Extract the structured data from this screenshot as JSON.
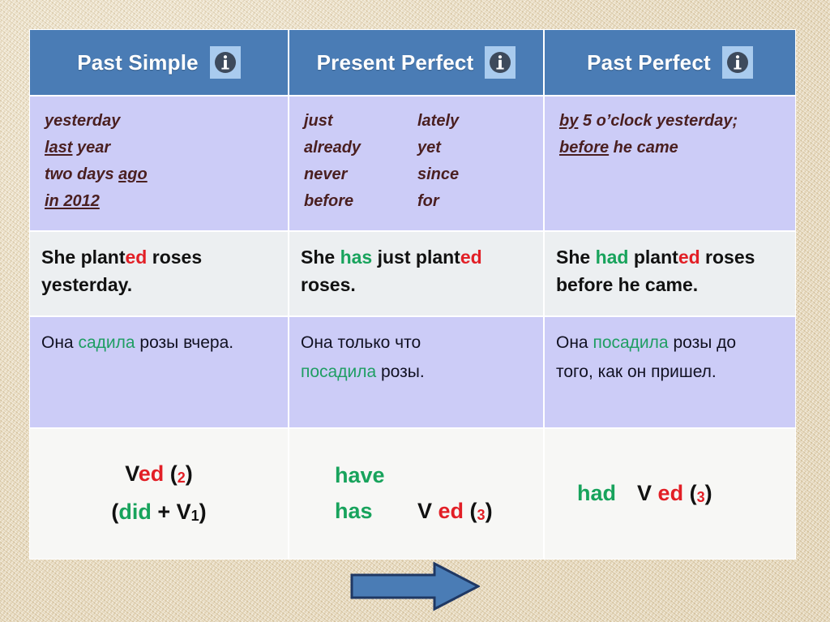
{
  "page": {
    "title": "English Tenses Comparison Table",
    "background_color": "#e8dcc0"
  },
  "colors": {
    "header_blue": "#4a7cb5",
    "info_badge_blue": "#a9cbee",
    "lavender_row": "#ccccf7",
    "light_row": "#eceff1",
    "formula_row": "#f7f7f5",
    "red_accent": "#e21f26",
    "green_accent": "#18a35c",
    "marker_text": "#4a1f20",
    "arrow_fill": "#4a7cb5",
    "arrow_outline": "#1f3864"
  },
  "table": {
    "headers": [
      {
        "label": "Past Simple",
        "icon": "info-icon"
      },
      {
        "label": "Present Perfect",
        "icon": "info-icon"
      },
      {
        "label": "Past Perfect",
        "icon": "info-icon"
      }
    ],
    "markers": {
      "past_simple": {
        "lines": [
          {
            "plain": "yesterday",
            "underlined": ""
          },
          {
            "underlined": "last",
            "plain": " year"
          },
          {
            "plain": "two days ",
            "underlined": "ago"
          },
          {
            "underlined": "in 2012",
            "plain": ""
          }
        ],
        "col_a": [
          "yesterday",
          "last year",
          "two days ago",
          "in 2012"
        ]
      },
      "present_perfect": {
        "col_a": [
          "just",
          "already",
          "never",
          "before"
        ],
        "col_b": [
          "lately",
          "yet",
          "since",
          "for"
        ]
      },
      "past_perfect": {
        "line1_underlined": "by",
        "line1_plain": " 5 o’clock yesterday;",
        "line2_underlined": "before",
        "line2_plain": " he came"
      }
    },
    "english_examples": {
      "past_simple": {
        "p1": "She  plant",
        "red1": "ed",
        "p2": " roses",
        "p3": "yesterday."
      },
      "present_perfect": {
        "p1": "She ",
        "green1": "has",
        "p2": " just plant",
        "red1": "ed",
        "p3": "roses."
      },
      "past_perfect": {
        "p1": "She ",
        "green1": "had",
        "p2": " plant",
        "red1": "ed",
        "p3": " roses",
        "p4": "before he came."
      }
    },
    "russian_examples": {
      "past_simple": {
        "p1": "Она ",
        "green1": "садила",
        "p2": " розы вчера."
      },
      "present_perfect": {
        "p1": "Она только что",
        "green1": "посадила",
        "p2": " розы."
      },
      "past_perfect": {
        "p1": "Она  ",
        "green1": "посадила",
        "p2": " розы до",
        "p3": "того, как он пришел."
      }
    },
    "formulas": {
      "past_simple": {
        "line1_v": "V",
        "line1_ed": "ed",
        "line1_open": " (",
        "line1_num": "2",
        "line1_close": ")",
        "line2_open": "(",
        "line2_did": "did",
        "line2_plus": " + V",
        "line2_num": "1",
        "line2_close": ")"
      },
      "present_perfect": {
        "aux1": "have",
        "aux2": "has",
        "v": "V",
        "ed": "ed",
        "open": " (",
        "num": "3",
        "close": ")"
      },
      "past_perfect": {
        "aux": "had",
        "v": "V",
        "ed": "ed",
        "open": " (",
        "num": "3",
        "close": ")"
      }
    }
  },
  "arrow": {
    "name": "progress-arrow",
    "direction": "right"
  }
}
